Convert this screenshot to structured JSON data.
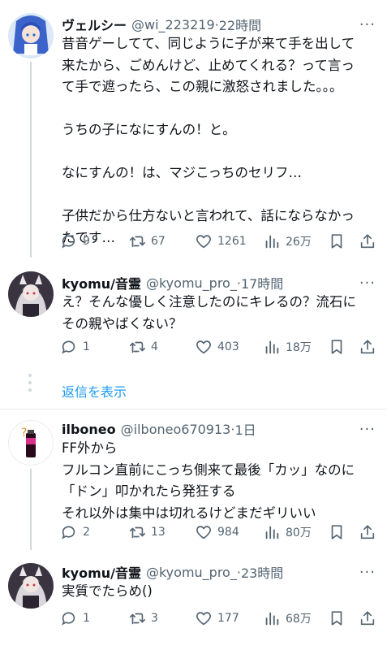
{
  "tweets": [
    {
      "name": "ヴェルシー",
      "handle": "@wi_223219",
      "time": "22時間",
      "lines": [
        "昔音ゲーしてて、同じように子が来て手を出して",
        "来たから、ごめんけど、止めてくれる？って言っ",
        "て手で遮ったら、この親に激怒されました。。。",
        "",
        "うちの子になにすんの！と。",
        "",
        "なにすんの！は、マジこっちのセリフ…",
        "",
        "子供だから仕方ないと言われて、話にならなかっ",
        "たです…"
      ],
      "replies": "9",
      "retweets": "67",
      "likes": "1261",
      "views": "26万"
    },
    {
      "name": "kyomu/音霊",
      "handle": "@kyomu_pro_",
      "time": "17時間",
      "lines": [
        "え？そんな優しく注意したのにキレるの？流石に",
        "その親やばくない？"
      ],
      "replies": "1",
      "retweets": "4",
      "likes": "403",
      "views": "18万"
    },
    {
      "name": "ilboneo",
      "handle": "@ilboneo670913",
      "time": "1日",
      "lines": [
        "FF外から",
        "フルコン直前にこっち側来て最後「カッ」なのに",
        "「ドン」叩かれたら発狂する",
        "それ以外は集中は切れるけどまだギリいい"
      ],
      "replies": "2",
      "retweets": "13",
      "likes": "984",
      "views": "80万"
    },
    {
      "name": "kyomu/音霊",
      "handle": "@kyomu_pro_",
      "time": "23時間",
      "lines": [
        "実質でたらめ()"
      ],
      "replies": "1",
      "retweets": "3",
      "likes": "177",
      "views": "68万"
    }
  ],
  "show_replies": "返信を表示",
  "separator": "·",
  "more": "···"
}
